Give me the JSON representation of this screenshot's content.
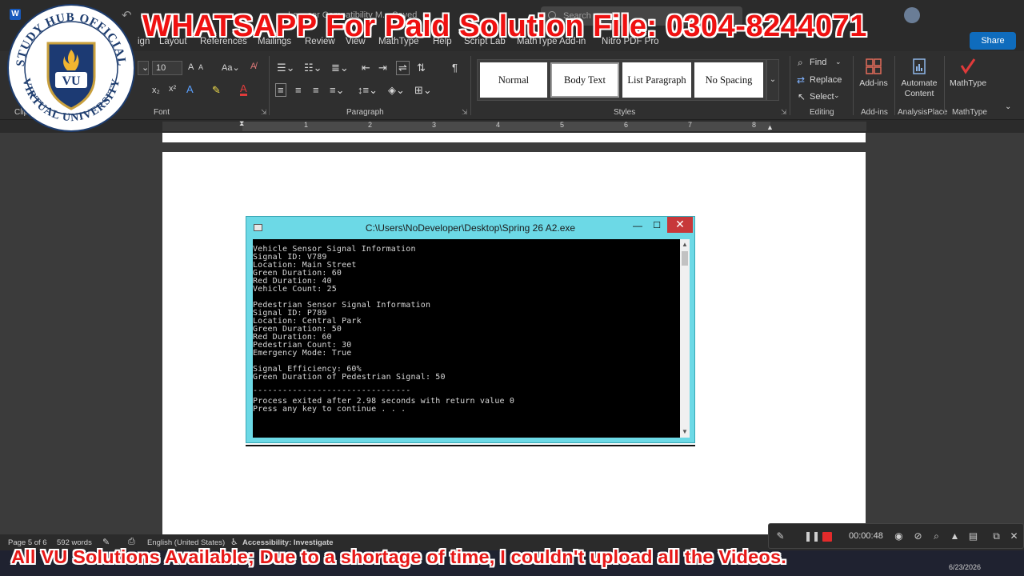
{
  "titlebar": {
    "document_title": "La... ser Compatibility M... Saved",
    "search_placeholder": "Search"
  },
  "tabs": [
    "ign",
    "Layout",
    "References",
    "Mailings",
    "Review",
    "View",
    "MathType",
    "Help",
    "Script Lab",
    "MathType Add-in",
    "Nitro PDF Pro"
  ],
  "share_label": "Share",
  "ribbon": {
    "clipboard_label": "Clip",
    "font_label": "Font",
    "paragraph_label": "Paragraph",
    "styles_label": "Styles",
    "editing_label": "Editing",
    "addins_label": "Add-ins",
    "analysisplace_label": "AnalysisPlace",
    "mathtype_label": "MathType",
    "font_size": "10",
    "styles": [
      "Normal",
      "Body Text",
      "List Paragraph",
      "No Spacing"
    ],
    "find_label": "Find",
    "replace_label": "Replace",
    "select_label": "Select",
    "addins_button": "Add-ins",
    "automate_line1": "Automate",
    "automate_line2": "Content",
    "mathtype_button": "MathType"
  },
  "ruler": {
    "numbers": [
      "1",
      "2",
      "3",
      "4",
      "5",
      "6",
      "7",
      "8"
    ]
  },
  "console": {
    "title": "C:\\Users\\NoDeveloper\\Desktop\\Spring 26 A2.exe",
    "lines": [
      "Vehicle Sensor Signal Information",
      "Signal ID: V789",
      "Location: Main Street",
      "Green Duration: 60",
      "Red Duration: 40",
      "Vehicle Count: 25",
      "",
      "Pedestrian Sensor Signal Information",
      "Signal ID: P789",
      "Location: Central Park",
      "Green Duration: 50",
      "Red Duration: 60",
      "Pedestrian Count: 30",
      "Emergency Mode: True",
      "",
      "Signal Efficiency: 60%",
      "Green Duration of Pedestrian Signal: 50",
      "",
      "--------------------------------",
      "Process exited after 2.98 seconds with return value 0",
      "Press any key to continue . . ."
    ]
  },
  "statusbar": {
    "page": "Page 5 of 6",
    "words": "592 words",
    "language": "English (United States)",
    "accessibility": "Accessibility: Investigate"
  },
  "recorder": {
    "time": "00:00:48"
  },
  "taskbar": {
    "date": "6/23/2026"
  },
  "overlay": {
    "top_banner": "WHATSAPP For Paid Solution File: 0304-8244071",
    "bottom_banner": "All VU Solutions Available; Due to a shortage of time, I couldn't upload all the Videos.",
    "logo_text_top": "STUDY HUB OFFICIAL",
    "logo_text_bottom": "VIRTUAL UNIVERSITY",
    "logo_badge": "VU"
  },
  "colors": {
    "console_frame": "#6cd9e6",
    "close_button": "#c7383a",
    "watermark_red": "#ef1111",
    "accent_blue": "#0f6cbd"
  }
}
